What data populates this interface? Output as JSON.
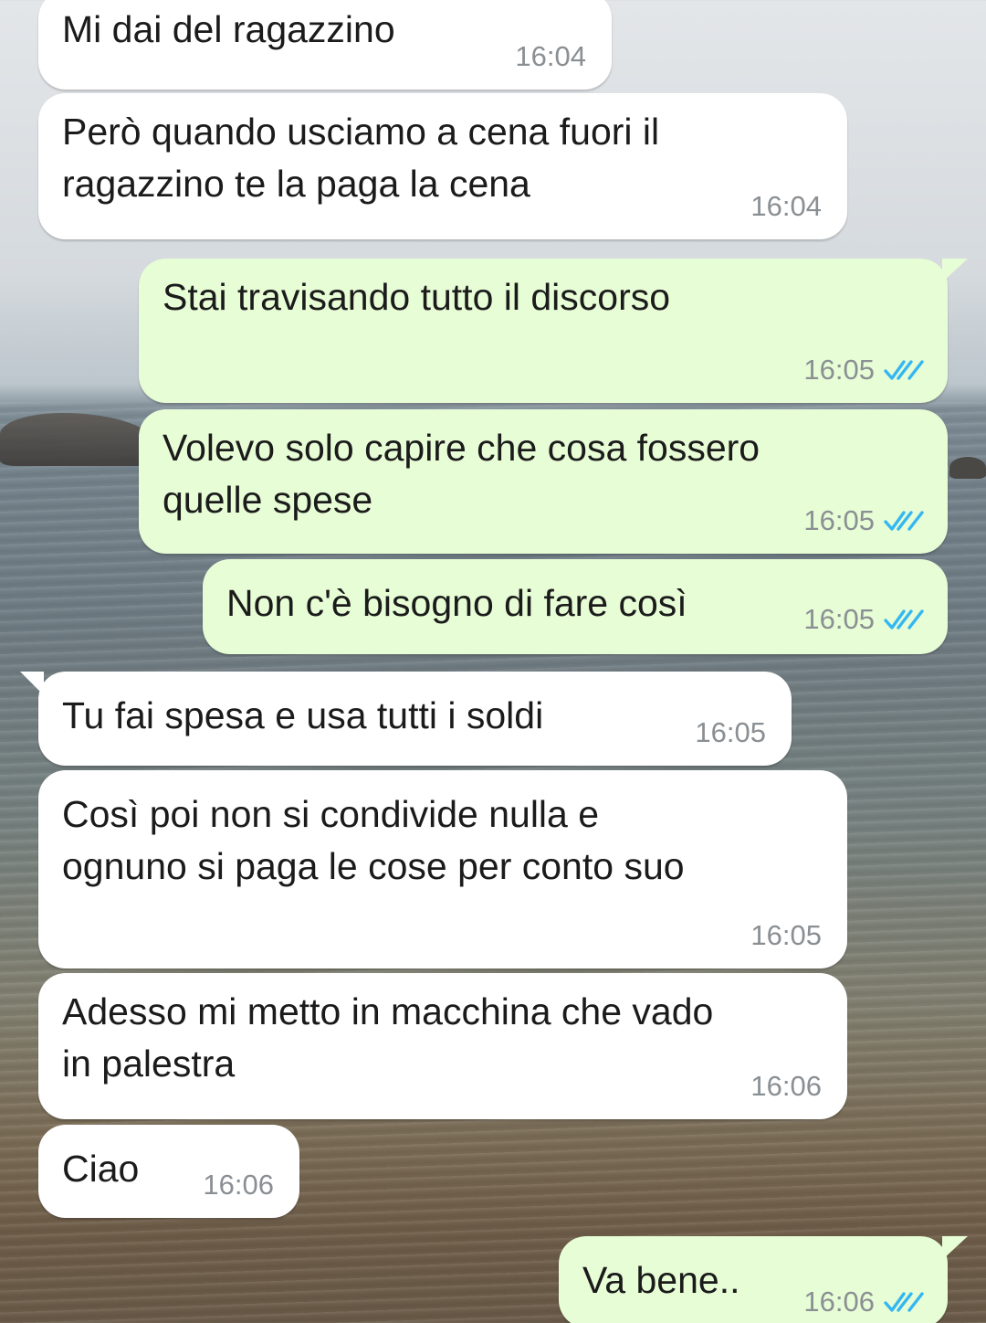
{
  "messages": [
    {
      "direction": "incoming",
      "text": "Mi dai del ragazzino",
      "time": "16:04"
    },
    {
      "direction": "incoming",
      "text": "Però quando usciamo a cena fuori il\nragazzino te la paga la cena",
      "time": "16:04"
    },
    {
      "direction": "outgoing",
      "text": "Stai travisando tutto il discorso",
      "time": "16:05",
      "status": "read"
    },
    {
      "direction": "outgoing",
      "text": "Volevo solo capire che cosa fossero\nquelle spese",
      "time": "16:05",
      "status": "read"
    },
    {
      "direction": "outgoing",
      "text": "Non c'è bisogno di fare così",
      "time": "16:05",
      "status": "read"
    },
    {
      "direction": "incoming",
      "text": "Tu fai spesa e usa tutti i soldi",
      "time": "16:05"
    },
    {
      "direction": "incoming",
      "text": "Così poi non si condivide nulla e\nognuno si paga le cose per conto suo",
      "time": "16:05"
    },
    {
      "direction": "incoming",
      "text": "Adesso mi metto in macchina che vado\nin palestra",
      "time": "16:06"
    },
    {
      "direction": "incoming",
      "text": "Ciao",
      "time": "16:06"
    },
    {
      "direction": "outgoing",
      "text": "Va bene..",
      "time": "16:06",
      "status": "read"
    }
  ],
  "colors": {
    "incoming_bubble": "#ffffff",
    "outgoing_bubble": "#e7fdd6",
    "read_tick": "#34b7f1",
    "timestamp": "#8a8f93"
  },
  "icons": {
    "read_status": "double-check-icon"
  }
}
